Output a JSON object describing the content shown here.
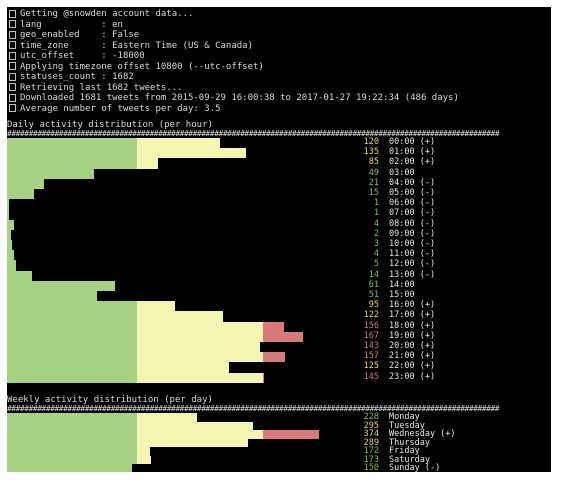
{
  "colors": {
    "green": "#a7d283",
    "yellow": "#f5f5b2",
    "red": "#d97a7a",
    "text": "#d9d9d9",
    "count_green": "#7fbf5a",
    "count_yellow": "#e8d56b",
    "count_red": "#d07a7a"
  },
  "header": [
    "Getting @snowden account data...",
    "lang           : en",
    "geo_enabled    : False",
    "time_zone      : Eastern Time (US & Canada)",
    "utc_offset     : -18000",
    "Applying timezone offset 10800 (--utc-offset)",
    "statuses_count : 1682",
    "Retrieving last 1682 tweets...",
    "Downloaded 1681 tweets from 2015-09-29 16:00:38 to 2017-01-27 19:22:34 (486 days)",
    "Average number of tweets per day: 3.5"
  ],
  "daily_title": "Daily activity distribution (per hour)",
  "hourly": [
    {
      "count": "120",
      "time": "00:00",
      "mark": "(+)",
      "cnum": 120,
      "ccol": "yellow"
    },
    {
      "count": "135",
      "time": "01:00",
      "mark": "(+)",
      "cnum": 135,
      "ccol": "yellow"
    },
    {
      "count": "85",
      "time": "02:00",
      "mark": "(+)",
      "cnum": 85,
      "ccol": "yellow"
    },
    {
      "count": "49",
      "time": "03:00",
      "mark": "",
      "cnum": 49,
      "ccol": "green"
    },
    {
      "count": "21",
      "time": "04:00",
      "mark": "(-)",
      "cnum": 21,
      "ccol": "green"
    },
    {
      "count": "15",
      "time": "05:00",
      "mark": "(-)",
      "cnum": 15,
      "ccol": "green"
    },
    {
      "count": "1",
      "time": "06:00",
      "mark": "(-)",
      "cnum": 1,
      "ccol": "green"
    },
    {
      "count": "1",
      "time": "07:00",
      "mark": "(-)",
      "cnum": 1,
      "ccol": "green"
    },
    {
      "count": "4",
      "time": "08:00",
      "mark": "(-)",
      "cnum": 4,
      "ccol": "green"
    },
    {
      "count": "2",
      "time": "09:00",
      "mark": "(-)",
      "cnum": 2,
      "ccol": "green"
    },
    {
      "count": "3",
      "time": "10:00",
      "mark": "(-)",
      "cnum": 3,
      "ccol": "green"
    },
    {
      "count": "4",
      "time": "11:00",
      "mark": "(-)",
      "cnum": 4,
      "ccol": "green"
    },
    {
      "count": "5",
      "time": "12:00",
      "mark": "(-)",
      "cnum": 5,
      "ccol": "green"
    },
    {
      "count": "14",
      "time": "13:00",
      "mark": "(-)",
      "cnum": 14,
      "ccol": "green"
    },
    {
      "count": "61",
      "time": "14:00",
      "mark": "",
      "cnum": 61,
      "ccol": "green"
    },
    {
      "count": "51",
      "time": "15:00",
      "mark": "",
      "cnum": 51,
      "ccol": "green"
    },
    {
      "count": "95",
      "time": "16:00",
      "mark": "(+)",
      "cnum": 95,
      "ccol": "yellow"
    },
    {
      "count": "122",
      "time": "17:00",
      "mark": "(+)",
      "cnum": 122,
      "ccol": "yellow"
    },
    {
      "count": "156",
      "time": "18:00",
      "mark": "(+)",
      "cnum": 156,
      "ccol": "red"
    },
    {
      "count": "167",
      "time": "19:00",
      "mark": "(+)",
      "cnum": 167,
      "ccol": "red"
    },
    {
      "count": "143",
      "time": "20:00",
      "mark": "(+)",
      "cnum": 143,
      "ccol": "red"
    },
    {
      "count": "157",
      "time": "21:00",
      "mark": "(+)",
      "cnum": 157,
      "ccol": "red"
    },
    {
      "count": "125",
      "time": "22:00",
      "mark": "(+)",
      "cnum": 125,
      "ccol": "yellow"
    },
    {
      "count": "145",
      "time": "23:00",
      "mark": "(+)",
      "cnum": 145,
      "ccol": "red"
    }
  ],
  "weekly_title": "Weekly activity distribution (per day)",
  "weekly": [
    {
      "count": "228",
      "day": "Monday",
      "mark": "",
      "cnum": 228,
      "ccol": "green"
    },
    {
      "count": "295",
      "day": "Tuesday",
      "mark": "",
      "cnum": 295,
      "ccol": "yellow"
    },
    {
      "count": "374",
      "day": "Wednesday",
      "mark": "(+)",
      "cnum": 374,
      "ccol": "yellow"
    },
    {
      "count": "289",
      "day": "Thursday",
      "mark": "",
      "cnum": 289,
      "ccol": "yellow"
    },
    {
      "count": "172",
      "day": "Friday",
      "mark": "",
      "cnum": 172,
      "ccol": "green"
    },
    {
      "count": "173",
      "day": "Saturday",
      "mark": "",
      "cnum": 173,
      "ccol": "green"
    },
    {
      "count": "150",
      "day": "Sunday",
      "mark": "(-)",
      "cnum": 150,
      "ccol": "green"
    }
  ]
}
